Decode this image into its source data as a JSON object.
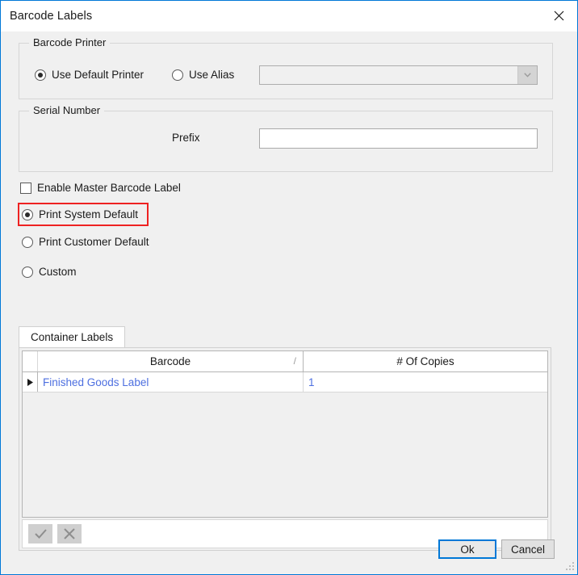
{
  "window": {
    "title": "Barcode Labels",
    "close_icon": "close-icon"
  },
  "printer_group": {
    "title": "Barcode Printer",
    "options": [
      {
        "label": "Use Default Printer",
        "checked": true
      },
      {
        "label": "Use Alias",
        "checked": false
      }
    ],
    "alias_combo": {
      "value": "",
      "enabled": false,
      "arrow_icon": "chevron-down-icon"
    }
  },
  "serial_group": {
    "title": "Serial Number",
    "prefix_label": "Prefix",
    "prefix_value": "",
    "prefix_placeholder": ""
  },
  "master_label": {
    "label": "Enable Master Barcode Label",
    "checked": false
  },
  "print_mode": {
    "options": [
      {
        "label": "Print System Default",
        "checked": true,
        "highlighted": true
      },
      {
        "label": "Print Customer Default",
        "checked": false,
        "highlighted": false
      },
      {
        "label": "Custom",
        "checked": false,
        "highlighted": false
      }
    ],
    "highlight_color": "#ee2222"
  },
  "tabs": [
    {
      "label": "Container Labels",
      "active": true
    }
  ],
  "grid": {
    "columns": [
      {
        "label": "Barcode",
        "sort_glyph": "/"
      },
      {
        "label": "# Of Copies",
        "sort_glyph": ""
      }
    ],
    "rows": [
      {
        "indicator": "▶",
        "barcode": "Finished Goods Label",
        "copies": "1"
      }
    ],
    "row_text_color": "#4d6fe0",
    "toolbar": [
      {
        "name": "accept-button",
        "icon": "check-icon",
        "enabled": false
      },
      {
        "name": "cancel-edit-button",
        "icon": "x-icon",
        "enabled": false
      }
    ]
  },
  "footer": {
    "ok_label": "Ok",
    "cancel_label": "Cancel",
    "accent_color": "#0078d7"
  }
}
